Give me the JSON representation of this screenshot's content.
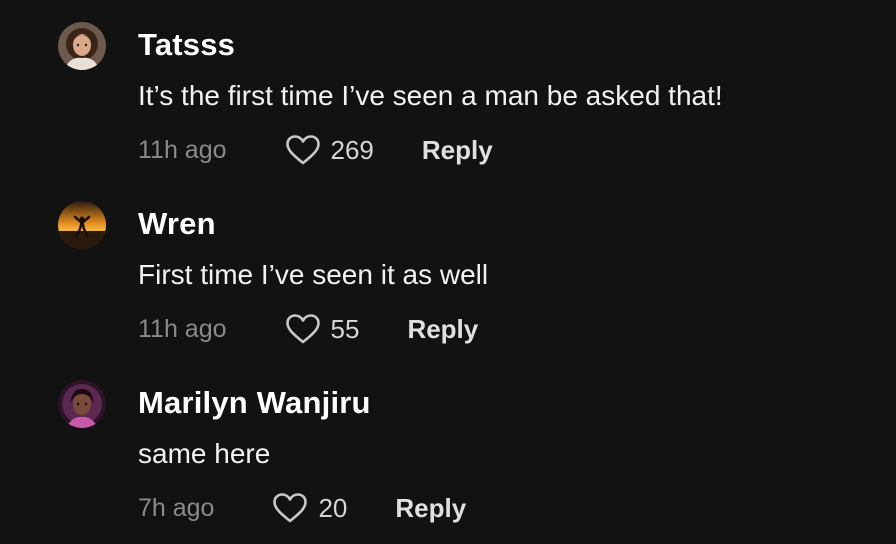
{
  "comments": [
    {
      "username": "Tatsss",
      "text": "It’s the first time I’ve seen a man be asked that!",
      "time": "11h ago",
      "likes": "269",
      "reply_label": "Reply",
      "avatar_icon": "profile-photo-woman-curly-hair"
    },
    {
      "username": "Wren",
      "text": "First time I’ve seen it as well",
      "time": "11h ago",
      "likes": "55",
      "reply_label": "Reply",
      "avatar_icon": "profile-photo-sunset-silhouette"
    },
    {
      "username": "Marilyn Wanjiru",
      "text": "same here",
      "time": "7h ago",
      "likes": "20",
      "reply_label": "Reply",
      "avatar_icon": "profile-photo-woman-purple"
    }
  ],
  "colors": {
    "background": "#121212",
    "username": "#ffffff",
    "text": "#f2f2f2",
    "time": "#8a8a8a",
    "like_icon": "#c8c8c8",
    "reply": "#e0e0e0"
  }
}
